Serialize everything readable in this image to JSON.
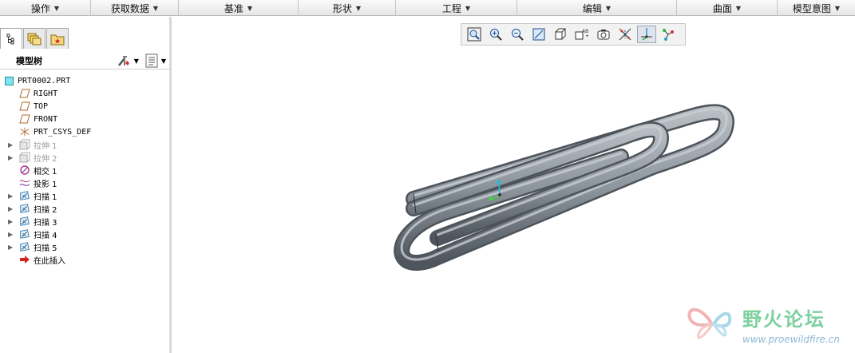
{
  "menubar": {
    "items": [
      {
        "label": "操作"
      },
      {
        "label": "获取数据"
      },
      {
        "label": "基准"
      },
      {
        "label": "形状"
      },
      {
        "label": "工程"
      },
      {
        "label": "编辑"
      },
      {
        "label": "曲面"
      },
      {
        "label": "模型意图"
      }
    ]
  },
  "panel": {
    "title": "模型树",
    "tabs": [
      "model-tree-tab",
      "layer-tree-tab",
      "favorites-tab"
    ]
  },
  "tree": {
    "root": "PRT0002.PRT",
    "items": [
      {
        "label": "RIGHT",
        "icon": "datum-plane-icon",
        "expandable": false,
        "dim": false,
        "mono": true
      },
      {
        "label": "TOP",
        "icon": "datum-plane-icon",
        "expandable": false,
        "dim": false,
        "mono": true
      },
      {
        "label": "FRONT",
        "icon": "datum-plane-icon",
        "expandable": false,
        "dim": false,
        "mono": true
      },
      {
        "label": "PRT_CSYS_DEF",
        "icon": "csys-icon",
        "expandable": false,
        "dim": false,
        "mono": true
      },
      {
        "label": "拉伸 1",
        "icon": "extrude-icon",
        "expandable": true,
        "dim": true,
        "mono": false
      },
      {
        "label": "拉伸 2",
        "icon": "extrude-icon",
        "expandable": true,
        "dim": true,
        "mono": false
      },
      {
        "label": "相交 1",
        "icon": "intersect-icon",
        "expandable": false,
        "dim": false,
        "mono": false
      },
      {
        "label": "投影 1",
        "icon": "projection-icon",
        "expandable": false,
        "dim": false,
        "mono": false
      },
      {
        "label": "扫描 1",
        "icon": "sweep-icon",
        "expandable": true,
        "dim": false,
        "mono": false
      },
      {
        "label": "扫描 2",
        "icon": "sweep-icon",
        "expandable": true,
        "dim": false,
        "mono": false
      },
      {
        "label": "扫描 3",
        "icon": "sweep-icon",
        "expandable": true,
        "dim": false,
        "mono": false
      },
      {
        "label": "扫描 4",
        "icon": "sweep-icon",
        "expandable": true,
        "dim": false,
        "mono": false
      },
      {
        "label": "扫描 5",
        "icon": "sweep-icon",
        "expandable": true,
        "dim": false,
        "mono": false
      },
      {
        "label": "在此插入",
        "icon": "insert-here-icon",
        "expandable": false,
        "dim": false,
        "mono": false
      }
    ]
  },
  "viewbar": {
    "buttons": [
      {
        "icon": "refit-icon",
        "on": false
      },
      {
        "icon": "zoom-in-icon",
        "on": false
      },
      {
        "icon": "zoom-out-icon",
        "on": false
      },
      {
        "icon": "repaint-icon",
        "on": false
      },
      {
        "icon": "display-style-icon",
        "on": false
      },
      {
        "icon": "saved-views-icon",
        "on": false
      },
      {
        "icon": "view-manager-icon",
        "on": false
      },
      {
        "icon": "datum-display-icon",
        "on": false
      },
      {
        "icon": "spin-center-icon",
        "on": true
      },
      {
        "icon": "annotation-display-icon",
        "on": false
      }
    ]
  },
  "watermark": {
    "title": "野火论坛",
    "url": "www.proewildfire.cn"
  },
  "colors": {
    "model": "#8e969e",
    "watermark_green": "#7ed0a0"
  }
}
